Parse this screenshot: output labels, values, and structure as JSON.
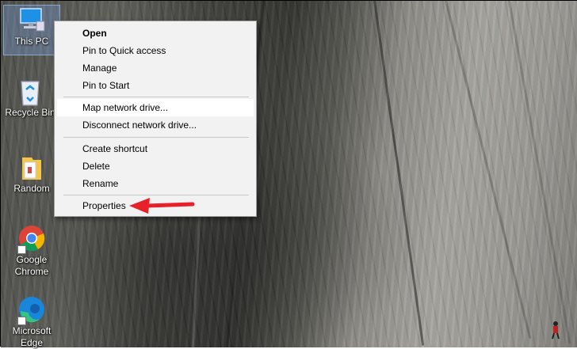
{
  "desktop": {
    "icons": [
      {
        "label": "This PC",
        "icon": "computer-icon"
      },
      {
        "label": "Recycle Bin",
        "icon": "recycle-bin-icon"
      },
      {
        "label": "Random",
        "icon": "folder-icon"
      },
      {
        "label": "Google Chrome",
        "icon": "chrome-icon"
      },
      {
        "label": "Microsoft Edge",
        "icon": "edge-icon"
      }
    ]
  },
  "context_menu": {
    "items": [
      {
        "label": "Open"
      },
      {
        "label": "Pin to Quick access"
      },
      {
        "label": "Manage"
      },
      {
        "label": "Pin to Start"
      },
      {
        "label": "Map network drive..."
      },
      {
        "label": "Disconnect network drive..."
      },
      {
        "label": "Create shortcut"
      },
      {
        "label": "Delete"
      },
      {
        "label": "Rename"
      },
      {
        "label": "Properties"
      }
    ]
  },
  "colors": {
    "annotation_arrow": "#e8202a",
    "menu_background": "#f2f2f2",
    "selection": "#78a0dc"
  }
}
